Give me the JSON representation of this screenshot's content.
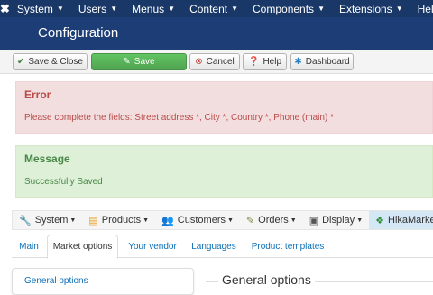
{
  "topnav": {
    "logo": "✖",
    "items": [
      "System",
      "Users",
      "Menus",
      "Content",
      "Components",
      "Extensions",
      "Help"
    ]
  },
  "header": {
    "title": "Configuration"
  },
  "toolbar": {
    "save_close": "Save & Close",
    "save": "Save",
    "cancel": "Cancel",
    "help": "Help",
    "dashboard": "Dashboard"
  },
  "error": {
    "heading": "Error",
    "text": "Please complete the fields: Street address *, City *, Country *, Phone (main) *"
  },
  "message": {
    "heading": "Message",
    "text": "Successfully Saved"
  },
  "hikanav": {
    "items": [
      "System",
      "Products",
      "Customers",
      "Orders",
      "Display",
      "HikaMarket"
    ]
  },
  "tabs": [
    "Main",
    "Market options",
    "Your vendor",
    "Languages",
    "Product templates"
  ],
  "sidebar": {
    "link": "General options"
  },
  "section": {
    "title": "General options"
  },
  "colors": {
    "nav": "#1a3867",
    "header": "#1c3d75",
    "error_bg": "#f2dede",
    "success_bg": "#dff0d8",
    "link": "#0b6fb7"
  }
}
